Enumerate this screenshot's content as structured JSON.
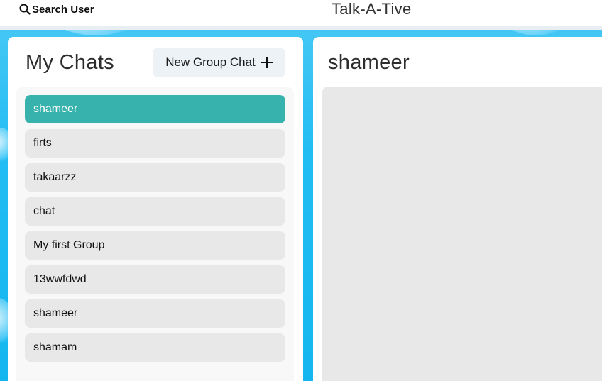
{
  "header": {
    "search_label": "Search User",
    "app_title": "Talk-A-Tive"
  },
  "chats_panel": {
    "title": "My Chats",
    "new_group_label": "New Group Chat",
    "items": [
      {
        "label": "shameer",
        "selected": true
      },
      {
        "label": "firts",
        "selected": false
      },
      {
        "label": "takaarzz",
        "selected": false
      },
      {
        "label": "chat",
        "selected": false
      },
      {
        "label": "My first Group",
        "selected": false
      },
      {
        "label": "13wwfdwd",
        "selected": false
      },
      {
        "label": "shameer",
        "selected": false
      },
      {
        "label": "shamam",
        "selected": false
      }
    ]
  },
  "chat_window": {
    "title": "shameer"
  },
  "colors": {
    "accent_selected": "#38b2ac",
    "background": "#1fbbf2"
  }
}
